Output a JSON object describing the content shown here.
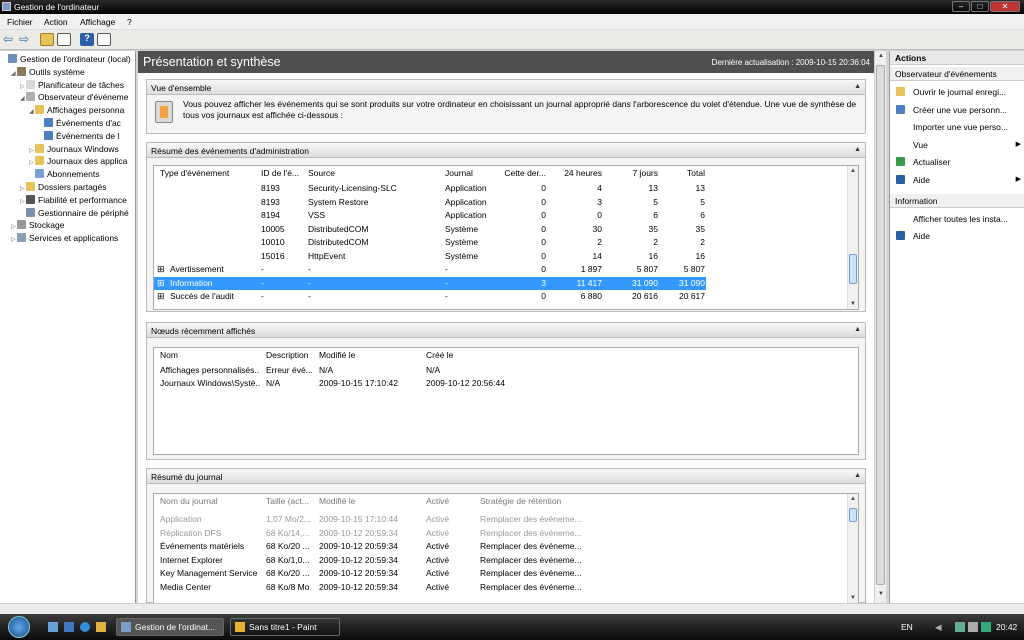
{
  "window": {
    "title": "Gestion de l'ordinateur"
  },
  "menu": [
    "Fichier",
    "Action",
    "Affichage",
    "?"
  ],
  "tree": [
    {
      "label": "Gestion de l'ordinateur (local)",
      "depth": 0,
      "icon": "computer-icon",
      "exp": ""
    },
    {
      "label": "Outils système",
      "depth": 1,
      "icon": "tools-icon",
      "exp": "◢"
    },
    {
      "label": "Planificateur de tâches",
      "depth": 2,
      "icon": "clock-icon",
      "exp": "▷"
    },
    {
      "label": "Observateur d'événeme",
      "depth": 2,
      "icon": "event-viewer-icon",
      "exp": "◢"
    },
    {
      "label": "Affichages personna",
      "depth": 3,
      "icon": "folder-icon",
      "exp": "◢"
    },
    {
      "label": "Événements d'ac",
      "depth": 4,
      "icon": "filter-icon",
      "exp": ""
    },
    {
      "label": "Événements de l",
      "depth": 4,
      "icon": "filter-icon",
      "exp": ""
    },
    {
      "label": "Journaux Windows",
      "depth": 3,
      "icon": "folder-icon",
      "exp": "▷"
    },
    {
      "label": "Journaux des applica",
      "depth": 3,
      "icon": "folder-icon",
      "exp": "▷"
    },
    {
      "label": "Abonnements",
      "depth": 3,
      "icon": "subscription-icon",
      "exp": ""
    },
    {
      "label": "Dossiers partagés",
      "depth": 2,
      "icon": "shared-folder-icon",
      "exp": "▷"
    },
    {
      "label": "Fiabilité et performance",
      "depth": 2,
      "icon": "performance-icon",
      "exp": "▷"
    },
    {
      "label": "Gestionnaire de périphé",
      "depth": 2,
      "icon": "device-manager-icon",
      "exp": ""
    },
    {
      "label": "Stockage",
      "depth": 1,
      "icon": "storage-icon",
      "exp": "▷"
    },
    {
      "label": "Services et applications",
      "depth": 1,
      "icon": "services-icon",
      "exp": "▷"
    }
  ],
  "center": {
    "title": "Présentation et synthèse",
    "last_update": "Dernière actualisation : 2009-10-15 20:36:04",
    "overview": {
      "heading": "Vue d'ensemble",
      "text": "Vous pouvez afficher les événements qui se sont produits sur votre ordinateur en choisissant un journal approprié dans l'arborescence du volet d'étendue. Une vue de synthèse de tous vos journaux est affichée ci-dessous :"
    },
    "admin": {
      "heading": "Résumé des événements d'administration",
      "columns": [
        "Type d'événement",
        "ID de l'é...",
        "Source",
        "Journal",
        "Cette der...",
        "24 heures",
        "7 jours",
        "Total"
      ],
      "rows": [
        {
          "type": "",
          "id": "8193",
          "source": "Security-Licensing-SLC",
          "log": "Application",
          "last": "0",
          "h24": "4",
          "d7": "13",
          "total": "13"
        },
        {
          "type": "",
          "id": "8193",
          "source": "System Restore",
          "log": "Application",
          "last": "0",
          "h24": "3",
          "d7": "5",
          "total": "5"
        },
        {
          "type": "",
          "id": "8194",
          "source": "VSS",
          "log": "Application",
          "last": "0",
          "h24": "0",
          "d7": "6",
          "total": "6"
        },
        {
          "type": "",
          "id": "10005",
          "source": "DistributedCOM",
          "log": "Système",
          "last": "0",
          "h24": "30",
          "d7": "35",
          "total": "35"
        },
        {
          "type": "",
          "id": "10010",
          "source": "DistributedCOM",
          "log": "Système",
          "last": "0",
          "h24": "2",
          "d7": "2",
          "total": "2"
        },
        {
          "type": "",
          "id": "15016",
          "source": "HttpEvent",
          "log": "Système",
          "last": "0",
          "h24": "14",
          "d7": "16",
          "total": "16"
        },
        {
          "type": "Avertissement",
          "id": "-",
          "source": "-",
          "log": "-",
          "last": "0",
          "h24": "1 897",
          "d7": "5 807",
          "total": "5 807"
        },
        {
          "type": "Information",
          "id": "-",
          "source": "-",
          "log": "-",
          "last": "3",
          "h24": "11 417",
          "d7": "31 090",
          "total": "31 090"
        },
        {
          "type": "Succès de l'audit",
          "id": "-",
          "source": "-",
          "log": "-",
          "last": "0",
          "h24": "6 880",
          "d7": "20 616",
          "total": "20 617"
        }
      ]
    },
    "recent": {
      "heading": "Nœuds récemment affichés",
      "columns": [
        "Nom",
        "Description",
        "Modifié le",
        "Créé le"
      ],
      "rows": [
        {
          "name": "Affichages personnalisés...",
          "desc": "Erreur évé...",
          "modified": "N/A",
          "created": "N/A"
        },
        {
          "name": "Journaux Windows\\Systè...",
          "desc": "N/A",
          "modified": "2009-10-15 17:10:42",
          "created": "2009-10-12 20:56:44"
        }
      ]
    },
    "logs": {
      "heading": "Résumé du journal",
      "columns": [
        "Nom du journal",
        "Taille (act...",
        "Modifié le",
        "Activé",
        "Stratégie de rétention"
      ],
      "rows": [
        {
          "name": "Application",
          "size": "1,07 Mo/2...",
          "modified": "2009-10-15 17:10:44",
          "enabled": "Activé",
          "policy": "Remplacer des événeme..."
        },
        {
          "name": "Réplication DFS",
          "size": "68 Ko/14,...",
          "modified": "2009-10-12 20:59:34",
          "enabled": "Activé",
          "policy": "Remplacer des événeme..."
        },
        {
          "name": "Événements matériels",
          "size": "68 Ko/20 ...",
          "modified": "2009-10-12 20:59:34",
          "enabled": "Activé",
          "policy": "Remplacer des événeme..."
        },
        {
          "name": "Internet Explorer",
          "size": "68 Ko/1,0...",
          "modified": "2009-10-12 20:59:34",
          "enabled": "Activé",
          "policy": "Remplacer des événeme..."
        },
        {
          "name": "Key Management Service",
          "size": "68 Ko/20 ...",
          "modified": "2009-10-12 20:59:34",
          "enabled": "Activé",
          "policy": "Remplacer des événeme..."
        },
        {
          "name": "Media Center",
          "size": "68 Ko/8 Mo",
          "modified": "2009-10-12 20:59:34",
          "enabled": "Activé",
          "policy": "Remplacer des événeme..."
        }
      ]
    }
  },
  "actions": {
    "title": "Actions",
    "section1": "Observateur d'événements",
    "items1": [
      {
        "label": "Ouvrir le journal enregi...",
        "icon": "open-log-icon",
        "arrow": ""
      },
      {
        "label": "Créer une vue personn...",
        "icon": "filter-icon",
        "arrow": ""
      },
      {
        "label": "Importer une vue perso...",
        "icon": "",
        "arrow": ""
      },
      {
        "label": "Vue",
        "icon": "",
        "arrow": "▶"
      },
      {
        "label": "Actualiser",
        "icon": "refresh-icon",
        "arrow": ""
      },
      {
        "label": "Aide",
        "icon": "help-icon",
        "arrow": "▶"
      }
    ],
    "section2": "Information",
    "items2": [
      {
        "label": "Afficher toutes les insta...",
        "icon": "",
        "arrow": ""
      },
      {
        "label": "Aide",
        "icon": "help-icon",
        "arrow": ""
      }
    ]
  },
  "taskbar": {
    "tasks": [
      "Gestion de l'ordinat...",
      "Sans titre1 - Paint"
    ],
    "lang": "EN",
    "clock": "20:42"
  },
  "colors": {
    "header_bg": "#4f4f4f",
    "selection": "#3399ff",
    "accent": "#1e5aa8"
  }
}
